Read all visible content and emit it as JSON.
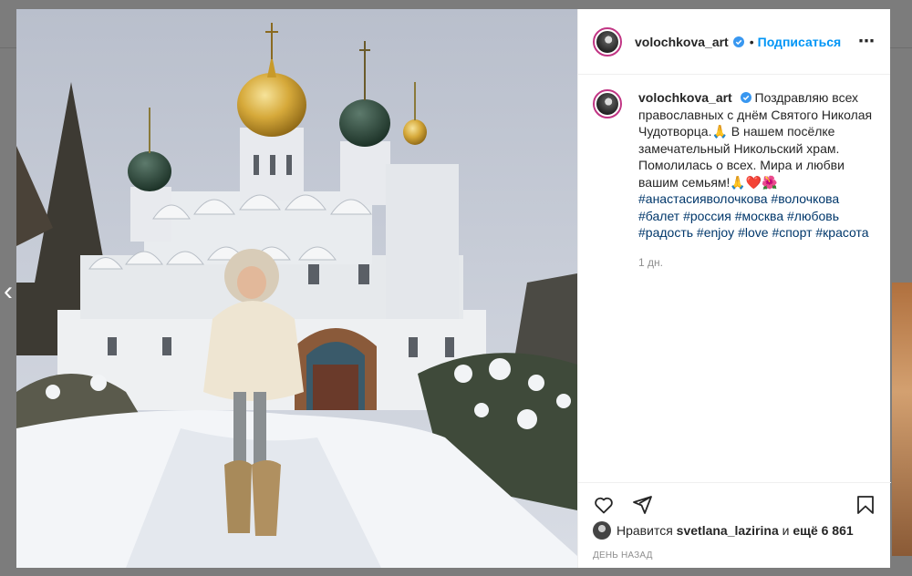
{
  "post": {
    "username": "volochkova_art",
    "follow_label": "Подписаться",
    "separator": "•",
    "more_icon": "⋯",
    "caption_text": "Поздравляю всех православных с днём Святого Николая Чудотворца.🙏 В нашем посёлке замечательный Никольский храм. Помолилась о всех. Мира и любви вашим семьям!🙏❤️🌺",
    "hashtags": [
      "#анастасияволочкова",
      "#волочкова",
      "#балет",
      "#россия",
      "#москва",
      "#любовь",
      "#радость",
      "#enjoy",
      "#love",
      "#спорт",
      "#красота"
    ],
    "time_ago": "1 дн.",
    "likes_prefix": "Нравится",
    "likes_user": "svetlana_lazirina",
    "likes_middle": "и",
    "likes_suffix": "ещё 6 861",
    "date_label": "День назад"
  },
  "icons": {
    "like": "heart-icon",
    "share": "paper-plane-icon",
    "save": "bookmark-icon",
    "verified": "verified-badge-icon",
    "prev": "chevron-left-icon"
  },
  "colors": {
    "link": "#0095f6",
    "hashtag": "#00376b",
    "verified": "#3897f0",
    "text": "#262626",
    "muted": "#8e8e8e"
  },
  "nav": {
    "prev_glyph": "‹"
  }
}
